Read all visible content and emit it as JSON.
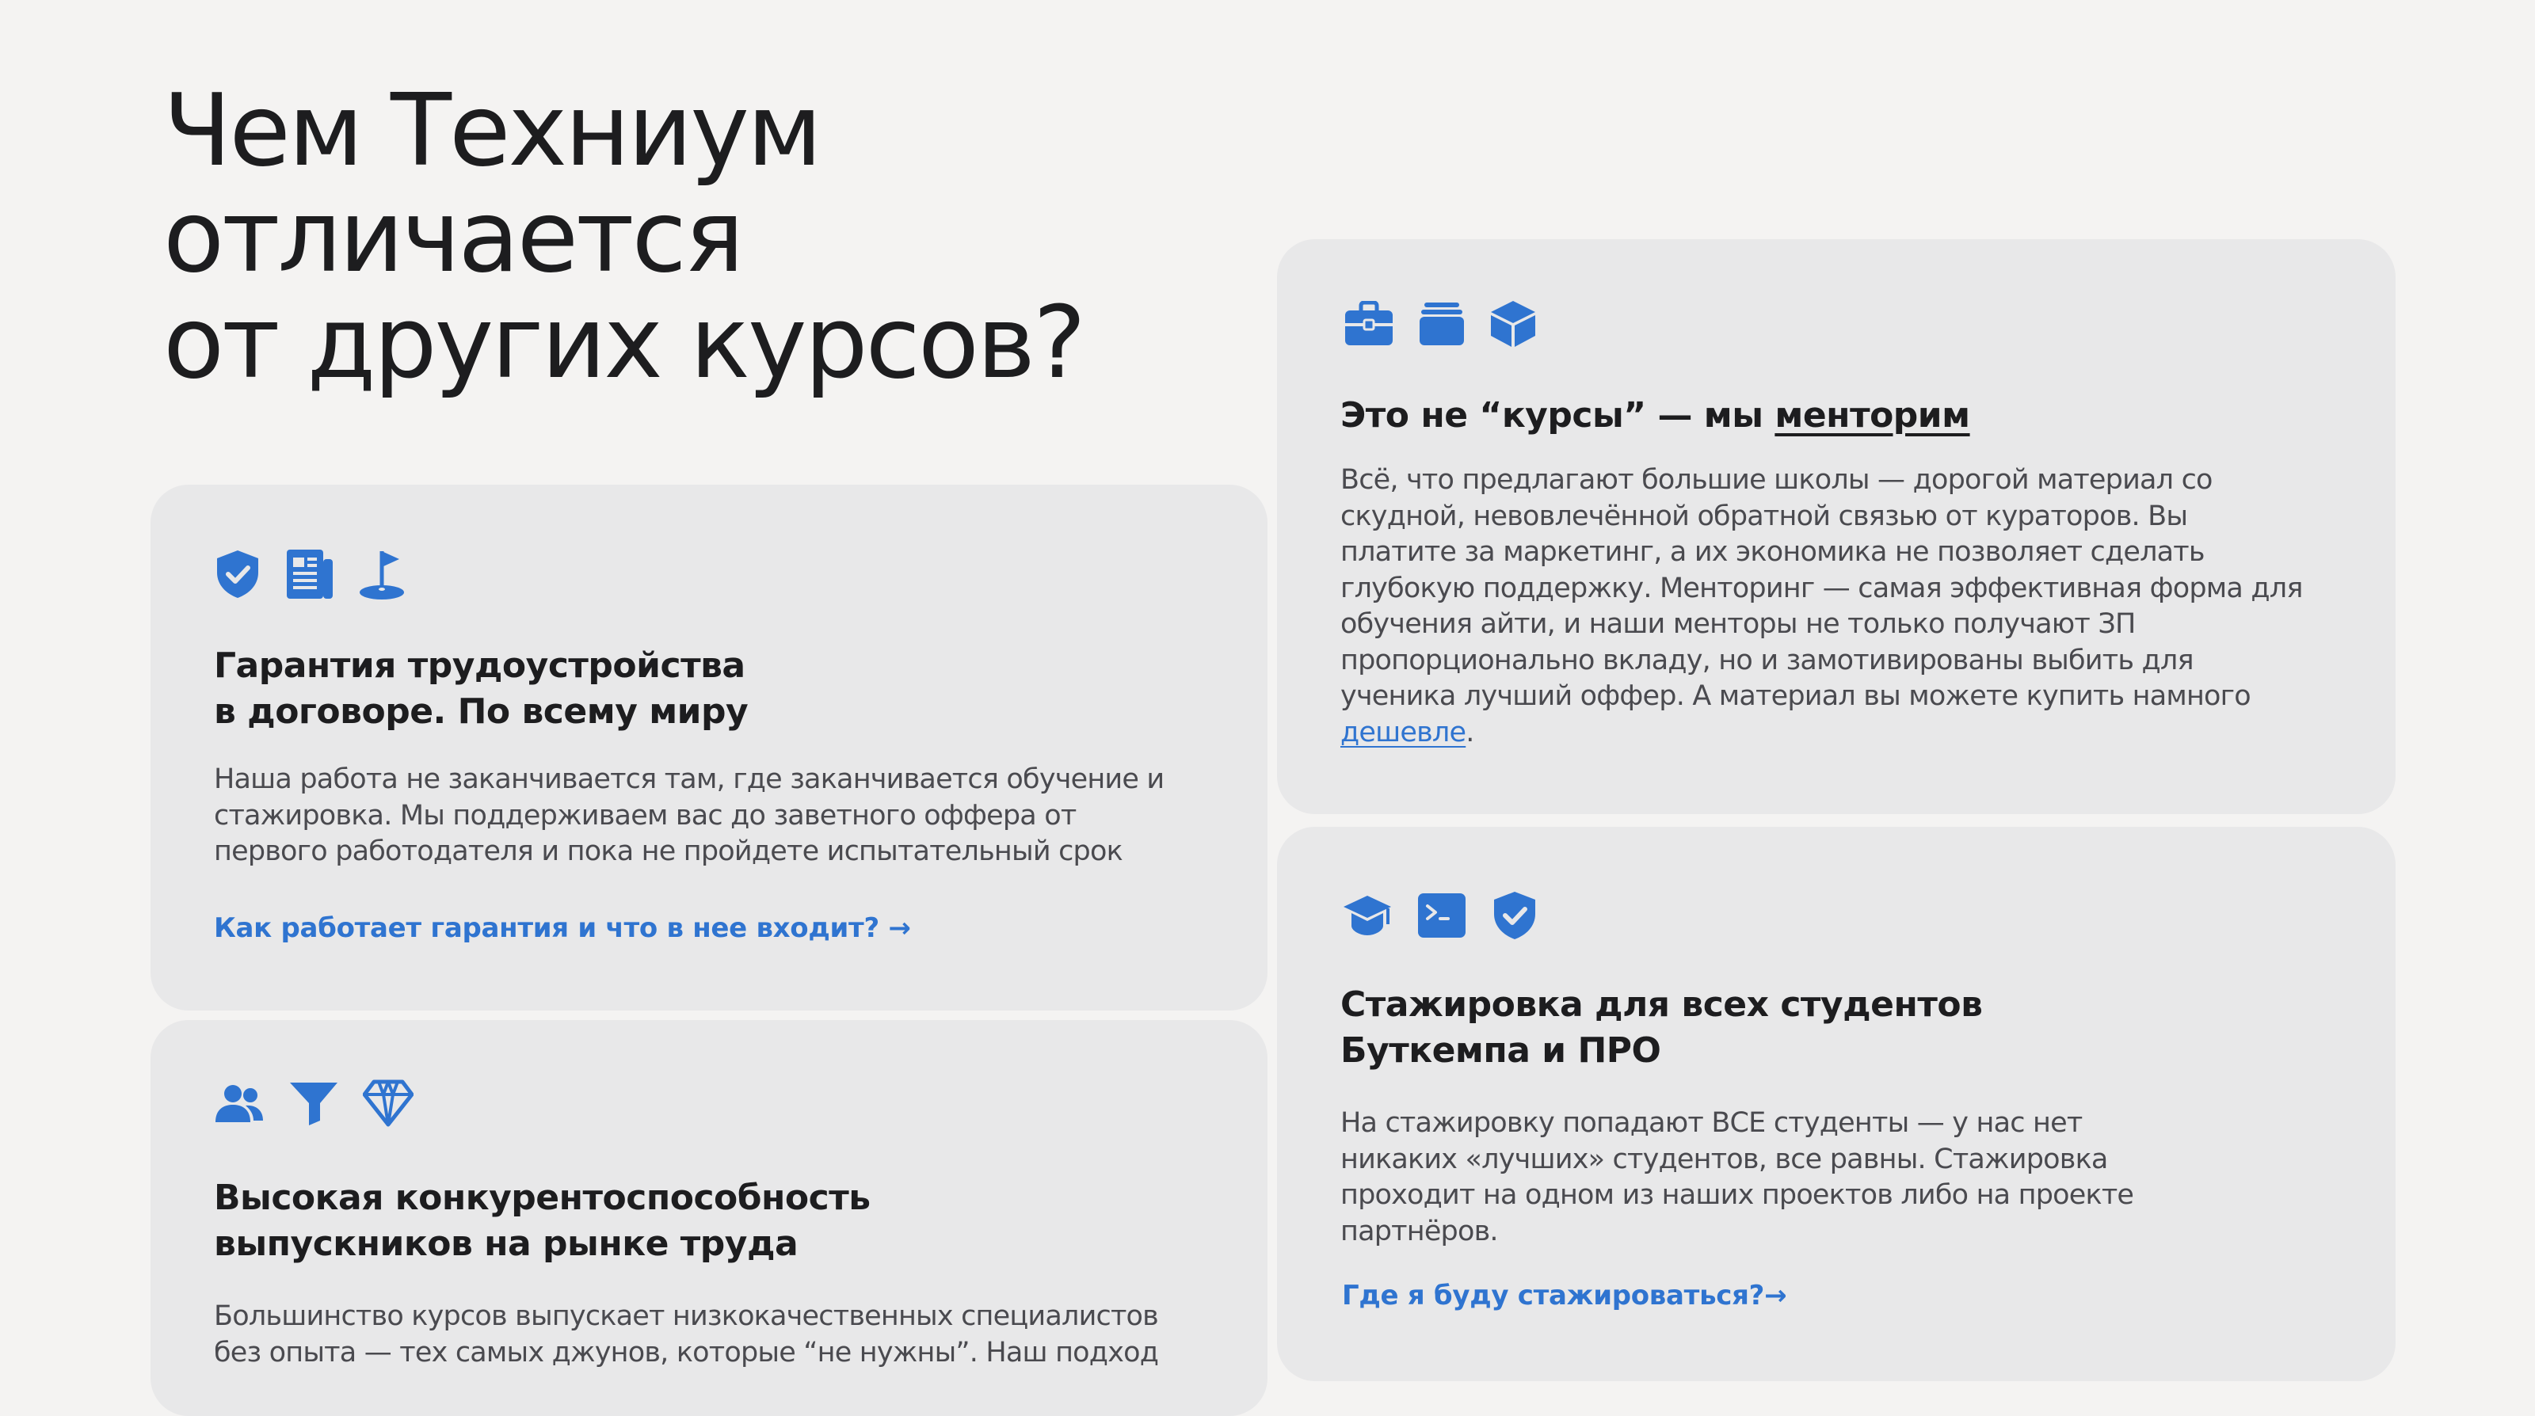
{
  "heading": {
    "lines": [
      "Чем Техниум",
      "отличается",
      "от других курсов?"
    ]
  },
  "colors": {
    "background": "#f4f3f2",
    "card": "#e8e8e9",
    "accent": "#2f74d0",
    "text": "#1d1d1f",
    "muted": "#4a4a4f"
  },
  "cards": {
    "guarantee": {
      "icons": [
        "shield-check-icon",
        "newspaper-icon",
        "golf-flag-icon"
      ],
      "title_lines": [
        "Гарантия трудоустройства",
        "в договоре. По всему миру"
      ],
      "text_lines": [
        "Наша работа не заканчивается там, где заканчивается обучение и",
        "стажировка. Мы поддерживаем вас до заветного оффера от",
        "первого работодателя и пока не пройдете испытательный срок"
      ],
      "link": "Как работает гарантия и что в нее входит? →"
    },
    "competitive": {
      "icons": [
        "users-icon",
        "funnel-icon",
        "diamond-icon"
      ],
      "title_lines": [
        "Высокая конкурентоспособность",
        "выпускников на рынке труда"
      ],
      "text_lines": [
        "Большинство курсов выпускает низкокачественных специалистов",
        "без опыта — тех самых джунов, которые “не нужны”. Наш подход"
      ]
    },
    "mentoring": {
      "icons": [
        "briefcase-icon",
        "folder-icon",
        "cube-icon"
      ],
      "title_prefix": "Это не “курсы” — мы ",
      "title_link": "менторим",
      "text_lines": [
        "Всё, что предлагают большие школы — дорогой материал со",
        "скудной, невовлечённой обратной связью от кураторов. Вы",
        "платите за маркетинг, а их экономика не позволяет сделать",
        "глубокую поддержку. Менторинг — самая эффективная форма для",
        "обучения айти, и наши менторы не только получают ЗП",
        "пропорционально вкладу, но и замотивированы выбить для",
        "ученика лучший оффер. А материал вы можете купить намного"
      ],
      "text_link": "дешевле",
      "text_after_link": "."
    },
    "internship": {
      "icons": [
        "graduation-cap-icon",
        "terminal-icon",
        "shield-check-icon"
      ],
      "title_lines": [
        "Стажировка для всех студентов",
        "Буткемпа и ПРО"
      ],
      "text_lines": [
        "На стажировку попадают ВСЕ студенты — у нас нет",
        "никаких «лучших» студентов, все равны. Стажировка",
        "проходит на одном из наших проектов либо на проекте",
        "партнёров."
      ],
      "link": "Где я буду стажироваться?→"
    }
  }
}
